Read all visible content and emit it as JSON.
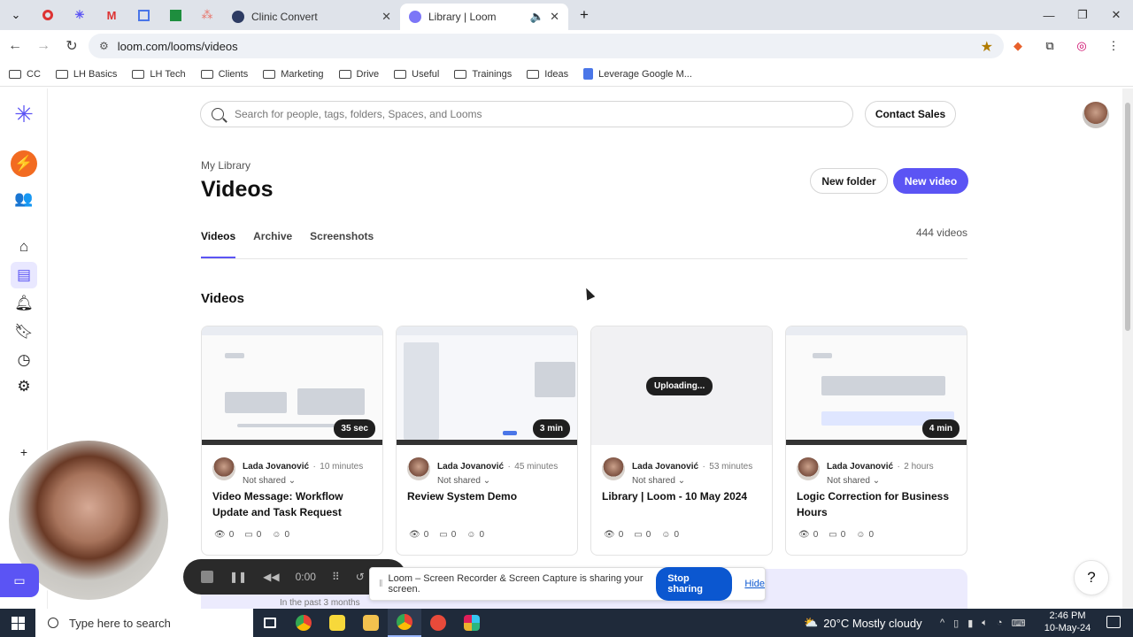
{
  "browser": {
    "tabs": [
      {
        "title": "Clinic Convert",
        "active": false
      },
      {
        "title": "Library | Loom",
        "active": true
      }
    ],
    "url": "loom.com/looms/videos",
    "bookmarks": [
      "CC",
      "LH Basics",
      "LH Tech",
      "Clients",
      "Marketing",
      "Drive",
      "Useful",
      "Trainings",
      "Ideas",
      "Leverage Google M..."
    ]
  },
  "header": {
    "search_placeholder": "Search for people, tags, folders, Spaces, and Looms",
    "contact_sales": "Contact Sales"
  },
  "page": {
    "breadcrumb": "My Library",
    "title": "Videos",
    "new_folder": "New folder",
    "new_video": "New video",
    "tabs": [
      "Videos",
      "Archive",
      "Screenshots"
    ],
    "count": "444 videos",
    "section_title": "Videos"
  },
  "videos": [
    {
      "author": "Lada Jovanović",
      "time": "10 minutes",
      "sharing": "Not shared",
      "title": "Video Message: Workflow Update and Task Request",
      "duration": "35 sec",
      "views": "0",
      "comments": "0",
      "reactions": "0"
    },
    {
      "author": "Lada Jovanović",
      "time": "45 minutes",
      "sharing": "Not shared",
      "title": "Review System Demo",
      "duration": "3 min",
      "views": "0",
      "comments": "0",
      "reactions": "0"
    },
    {
      "author": "Lada Jovanović",
      "time": "53 minutes",
      "sharing": "Not shared",
      "title": "Library | Loom - 10 May 2024",
      "status": "Uploading...",
      "views": "0",
      "comments": "0",
      "reactions": "0"
    },
    {
      "author": "Lada Jovanović",
      "time": "2 hours",
      "sharing": "Not shared",
      "title": "Logic Correction for Business Hours",
      "duration": "4 min",
      "views": "0",
      "comments": "0",
      "reactions": "0"
    }
  ],
  "bottom_band_text": "In the past 3 months",
  "recorder": {
    "timer": "0:00"
  },
  "sharing_bar": {
    "message": "Loom – Screen Recorder & Screen Capture is sharing your screen.",
    "stop": "Stop sharing",
    "hide": "Hide"
  },
  "help": "?",
  "taskbar": {
    "search": "Type here to search",
    "weather": "20°C  Mostly cloudy",
    "time": "2:46 PM",
    "date": "10-May-24"
  },
  "colors": {
    "accent": "#5b54f4",
    "chrome_blue": "#0b57d0"
  }
}
